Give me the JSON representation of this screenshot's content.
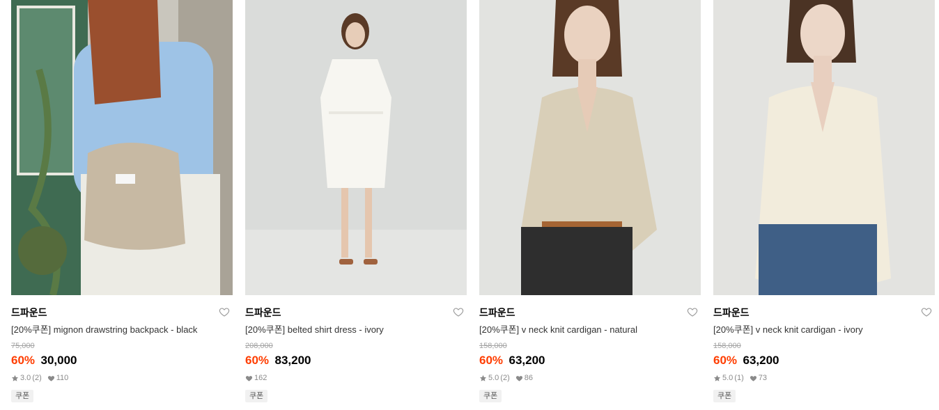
{
  "products": [
    {
      "brand": "드파운드",
      "name": "[20%쿠폰] mignon drawstring backpack - black",
      "original_price": "75,000",
      "discount": "60%",
      "price": "30,000",
      "rating": "3.0",
      "reviews": "(2)",
      "likes": "110",
      "badge": "쿠폰",
      "image_icon": "product-photo-backpack"
    },
    {
      "brand": "드파운드",
      "name": "[20%쿠폰] belted shirt dress - ivory",
      "original_price": "208,000",
      "discount": "60%",
      "price": "83,200",
      "likes": "162",
      "badge": "쿠폰",
      "image_icon": "product-photo-dress"
    },
    {
      "brand": "드파운드",
      "name": "[20%쿠폰] v neck knit cardigan - natural",
      "original_price": "158,000",
      "discount": "60%",
      "price": "63,200",
      "rating": "5.0",
      "reviews": "(2)",
      "likes": "86",
      "badge": "쿠폰",
      "image_icon": "product-photo-cardigan-natural"
    },
    {
      "brand": "드파운드",
      "name": "[20%쿠폰] v neck knit cardigan - ivory",
      "original_price": "158,000",
      "discount": "60%",
      "price": "63,200",
      "rating": "5.0",
      "reviews": "(1)",
      "likes": "73",
      "badge": "쿠폰",
      "image_icon": "product-photo-cardigan-ivory"
    }
  ],
  "colors": {
    "discount": "#ff3d00",
    "strike": "#a3a3a3",
    "meta": "#8a8a8a"
  }
}
